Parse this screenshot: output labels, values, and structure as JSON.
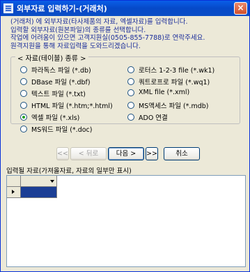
{
  "window": {
    "title": "외부자료 입력하기-(거래처)",
    "close_label": "×"
  },
  "info": {
    "lines": [
      "(거래처) 에 외부자료(타사제품의 자료, 엑셀자료)를 입력합니다.",
      "입력할 외부자료(원본파일)의 종류를 선택합니다.",
      "작업에 어려움이 있으면 고객지원실(0505-855-7788)로 연락주세요.",
      "원격지원을 통해 자료입력을 도와드리겠습니다."
    ]
  },
  "file_type_group": {
    "legend": "< 자료(테이블) 종류 >",
    "options": [
      {
        "label": "파라독스 파일 (*.db)",
        "selected": false
      },
      {
        "label": "DBase 파일 (*.dbf)",
        "selected": false
      },
      {
        "label": "텍스트 파일 (*.txt)",
        "selected": false
      },
      {
        "label": "HTML 파일 (*.htm;*.html)",
        "selected": false
      },
      {
        "label": "엑셀 파일 (*.xls)",
        "selected": true
      },
      {
        "label": "MS워드 파일 (*.doc)",
        "selected": false
      },
      {
        "label": "로터스 1-2-3 file (*.wk1)",
        "selected": false
      },
      {
        "label": "쿼트로프로 파일 (*.wq1)",
        "selected": false
      },
      {
        "label": "XML file (*.xml)",
        "selected": false
      },
      {
        "label": "MS액세스 파일 (*.mdb)",
        "selected": false
      },
      {
        "label": "ADO 연결",
        "selected": false
      }
    ]
  },
  "nav": {
    "first_label": "<<",
    "prev_label": "< 뒤로",
    "next_label": "다음 >",
    "last_label": ">>",
    "cancel_label": "취소"
  },
  "grid": {
    "label": "입력될 자료(가져올자료, 자료의 일부만 표시)"
  }
}
